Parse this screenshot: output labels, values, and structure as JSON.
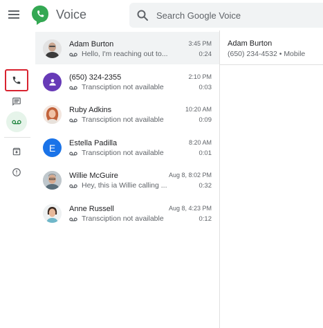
{
  "app": {
    "title": "Voice"
  },
  "search": {
    "placeholder": "Search Google Voice"
  },
  "colors": {
    "accent": "#34a853",
    "highlight": "#d8222f",
    "purple": "#673ab7",
    "blue": "#1a73e8"
  },
  "conversations": [
    {
      "name": "Adam Burton",
      "preview": "Hello, I'm reaching out to...",
      "time": "3:45 PM",
      "duration": "0:24",
      "avatar": "photo-bald-man"
    },
    {
      "name": "(650) 324-2355",
      "preview": "Transciption not available",
      "time": "2:10 PM",
      "duration": "0:03",
      "avatar": "person-icon"
    },
    {
      "name": "Ruby Adkins",
      "preview": "Transciption not available",
      "time": "10:20 AM",
      "duration": "0:09",
      "avatar": "photo-woman"
    },
    {
      "name": "Estella Padilla",
      "preview": "Transciption not available",
      "time": "8:20 AM",
      "duration": "0:01",
      "avatar": "E"
    },
    {
      "name": "Willie McGuire",
      "preview": "Hey, this ia Willie calling ...",
      "time": "Aug 8, 8:02 PM",
      "duration": "0:32",
      "avatar": "photo-older-man"
    },
    {
      "name": "Anne Russell",
      "preview": "Transciption not available",
      "time": "Aug 8, 4:23 PM",
      "duration": "0:12",
      "avatar": "photo-woman-dark"
    }
  ],
  "detail": {
    "name": "Adam Burton",
    "phone": "(650) 234-4532 • Mobile"
  }
}
